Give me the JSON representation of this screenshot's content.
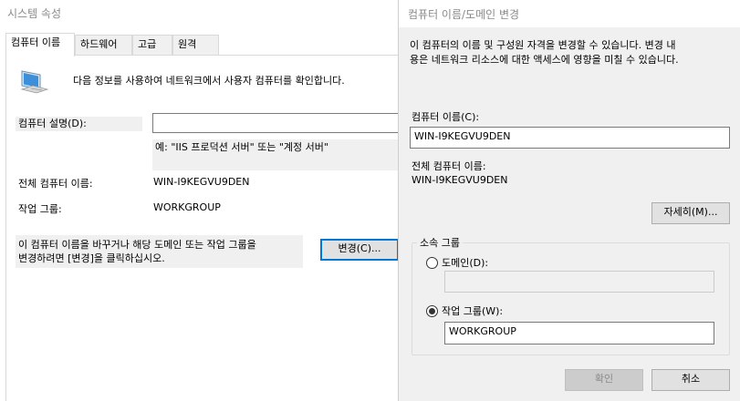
{
  "system_properties": {
    "title": "시스템 속성",
    "tabs": [
      {
        "label": "컴퓨터 이름",
        "active": true
      },
      {
        "label": "하드웨어",
        "active": false
      },
      {
        "label": "고급",
        "active": false
      },
      {
        "label": "원격",
        "active": false
      }
    ],
    "intro_text": "다음 정보를 사용하여 네트워크에서 사용자 컴퓨터를 확인합니다.",
    "description_label": "컴퓨터 설명(D):",
    "description_value": "",
    "example_text": "예: \"IIS 프로덕션 서버\" 또는 \"계정 서버\"",
    "full_name_label": "전체 컴퓨터 이름:",
    "full_name_value": "WIN-I9KEGVU9DEN",
    "workgroup_label": "작업 그룹:",
    "workgroup_value": "WORKGROUP",
    "rename_hint_line1": "이 컴퓨터 이름을 바꾸거나 해당 도메인 또는 작업 그룹을",
    "rename_hint_line2": "변경하려면 [변경]을 클릭하십시오.",
    "change_button": "변경(C)...",
    "computer_icon": "computer-monitor-icon"
  },
  "computer_name_dialog": {
    "title": "컴퓨터 이름/도메인 변경",
    "intro_line1": "이 컴퓨터의 이름 및 구성원 자격을 변경할 수 있습니다. 변경 내",
    "intro_line2": "용은 네트워크 리소스에 대한 액세스에 영향을 미칠 수 있습니다.",
    "computer_name_label": "컴퓨터 이름(C):",
    "computer_name_value": "WIN-I9KEGVU9DEN",
    "full_name_label": "전체 컴퓨터 이름:",
    "full_name_value": "WIN-I9KEGVU9DEN",
    "more_button": "자세히(M)...",
    "member_of_label": "소속 그룹",
    "domain_radio_label": "도메인(D):",
    "domain_value": "",
    "domain_selected": false,
    "workgroup_radio_label": "작업 그룹(W):",
    "workgroup_value": "WORKGROUP",
    "workgroup_selected": true,
    "ok_button": "확인",
    "ok_enabled": false,
    "cancel_button": "취소"
  },
  "colors": {
    "window_bg": "#ffffff",
    "dialog_bg": "#f0f0f0",
    "label_bg": "#f0f0f0",
    "focus_border": "#0078d7",
    "disabled_text": "#8a8a8a"
  }
}
